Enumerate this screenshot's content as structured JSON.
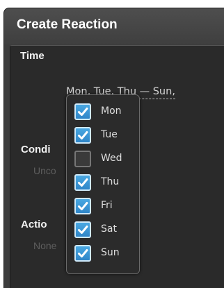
{
  "dialog": {
    "title": "Create Reaction"
  },
  "time": {
    "label": "Time",
    "value": "Mon, Tue, Thu — Sun,"
  },
  "conditions": {
    "label": "Condi",
    "value": "Unco"
  },
  "actions": {
    "label": "Actio",
    "value": "None"
  },
  "days": [
    {
      "label": "Mon",
      "checked": true
    },
    {
      "label": "Tue",
      "checked": true
    },
    {
      "label": "Wed",
      "checked": false
    },
    {
      "label": "Thu",
      "checked": true
    },
    {
      "label": "Fri",
      "checked": true
    },
    {
      "label": "Sat",
      "checked": true
    },
    {
      "label": "Sun",
      "checked": true
    }
  ],
  "colors": {
    "accent": "#3a97d6",
    "window": "#3d3d3d",
    "panel": "#2a2a2a"
  },
  "icons": {
    "checkbox_checked": "checkmark-icon"
  }
}
